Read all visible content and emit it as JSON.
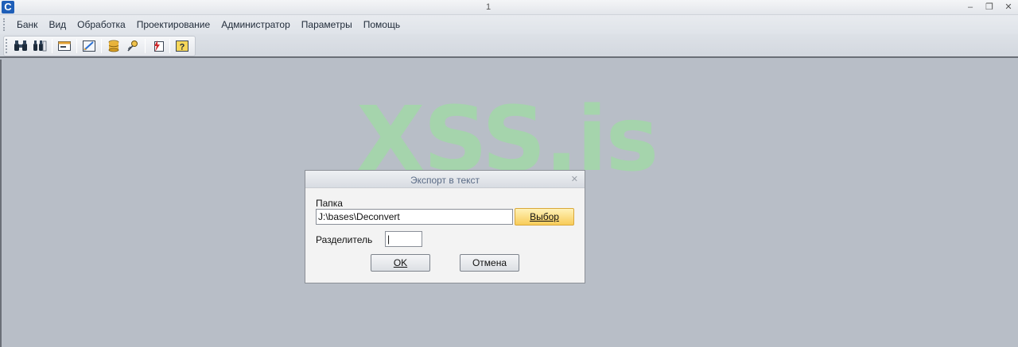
{
  "window": {
    "title": "1",
    "app_icon": "C",
    "controls": {
      "minimize": "–",
      "restore": "❐",
      "close": "✕"
    }
  },
  "menu": {
    "items": [
      "Банк",
      "Вид",
      "Обработка",
      "Проектирование",
      "Администратор",
      "Параметры",
      "Помощь"
    ]
  },
  "toolbar": {
    "icons": [
      "binoculars-icon",
      "binoculars-search-icon",
      "form-icon",
      "design-icon",
      "database-icon",
      "key-icon",
      "export-icon",
      "help-icon"
    ]
  },
  "watermark": {
    "text": "XSS.is",
    "color": "#96e696"
  },
  "dialog": {
    "title": "Экспорт в текст",
    "close_glyph": "✕",
    "folder_label": "Папка",
    "folder_value": "J:\\bases\\Deconvert",
    "browse_label": "Выбор",
    "separator_label": "Разделитель",
    "separator_value": "|",
    "ok_label": "OK",
    "cancel_label": "Отмена"
  },
  "colors": {
    "accent_button": "#f8cc5a",
    "workspace": "#b8bec7"
  }
}
